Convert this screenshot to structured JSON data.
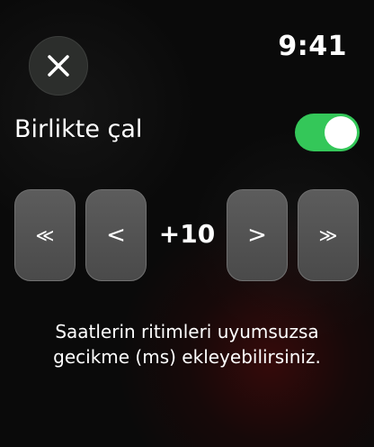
{
  "status_bar": {
    "time": "9:41"
  },
  "close_button": {
    "icon": "close-icon"
  },
  "sync_toggle": {
    "label": "Birlikte çal",
    "state": "on",
    "on_color": "#34c759"
  },
  "offset_stepper": {
    "decrease_large_glyph": "≪",
    "decrease_glyph": "<",
    "value": "+10",
    "increase_glyph": ">",
    "increase_large_glyph": "≫"
  },
  "help": {
    "line1": "Saatlerin ritimleri uyumsuzsa",
    "line2": "gecikme (ms) ekleyebilirsiniz."
  }
}
